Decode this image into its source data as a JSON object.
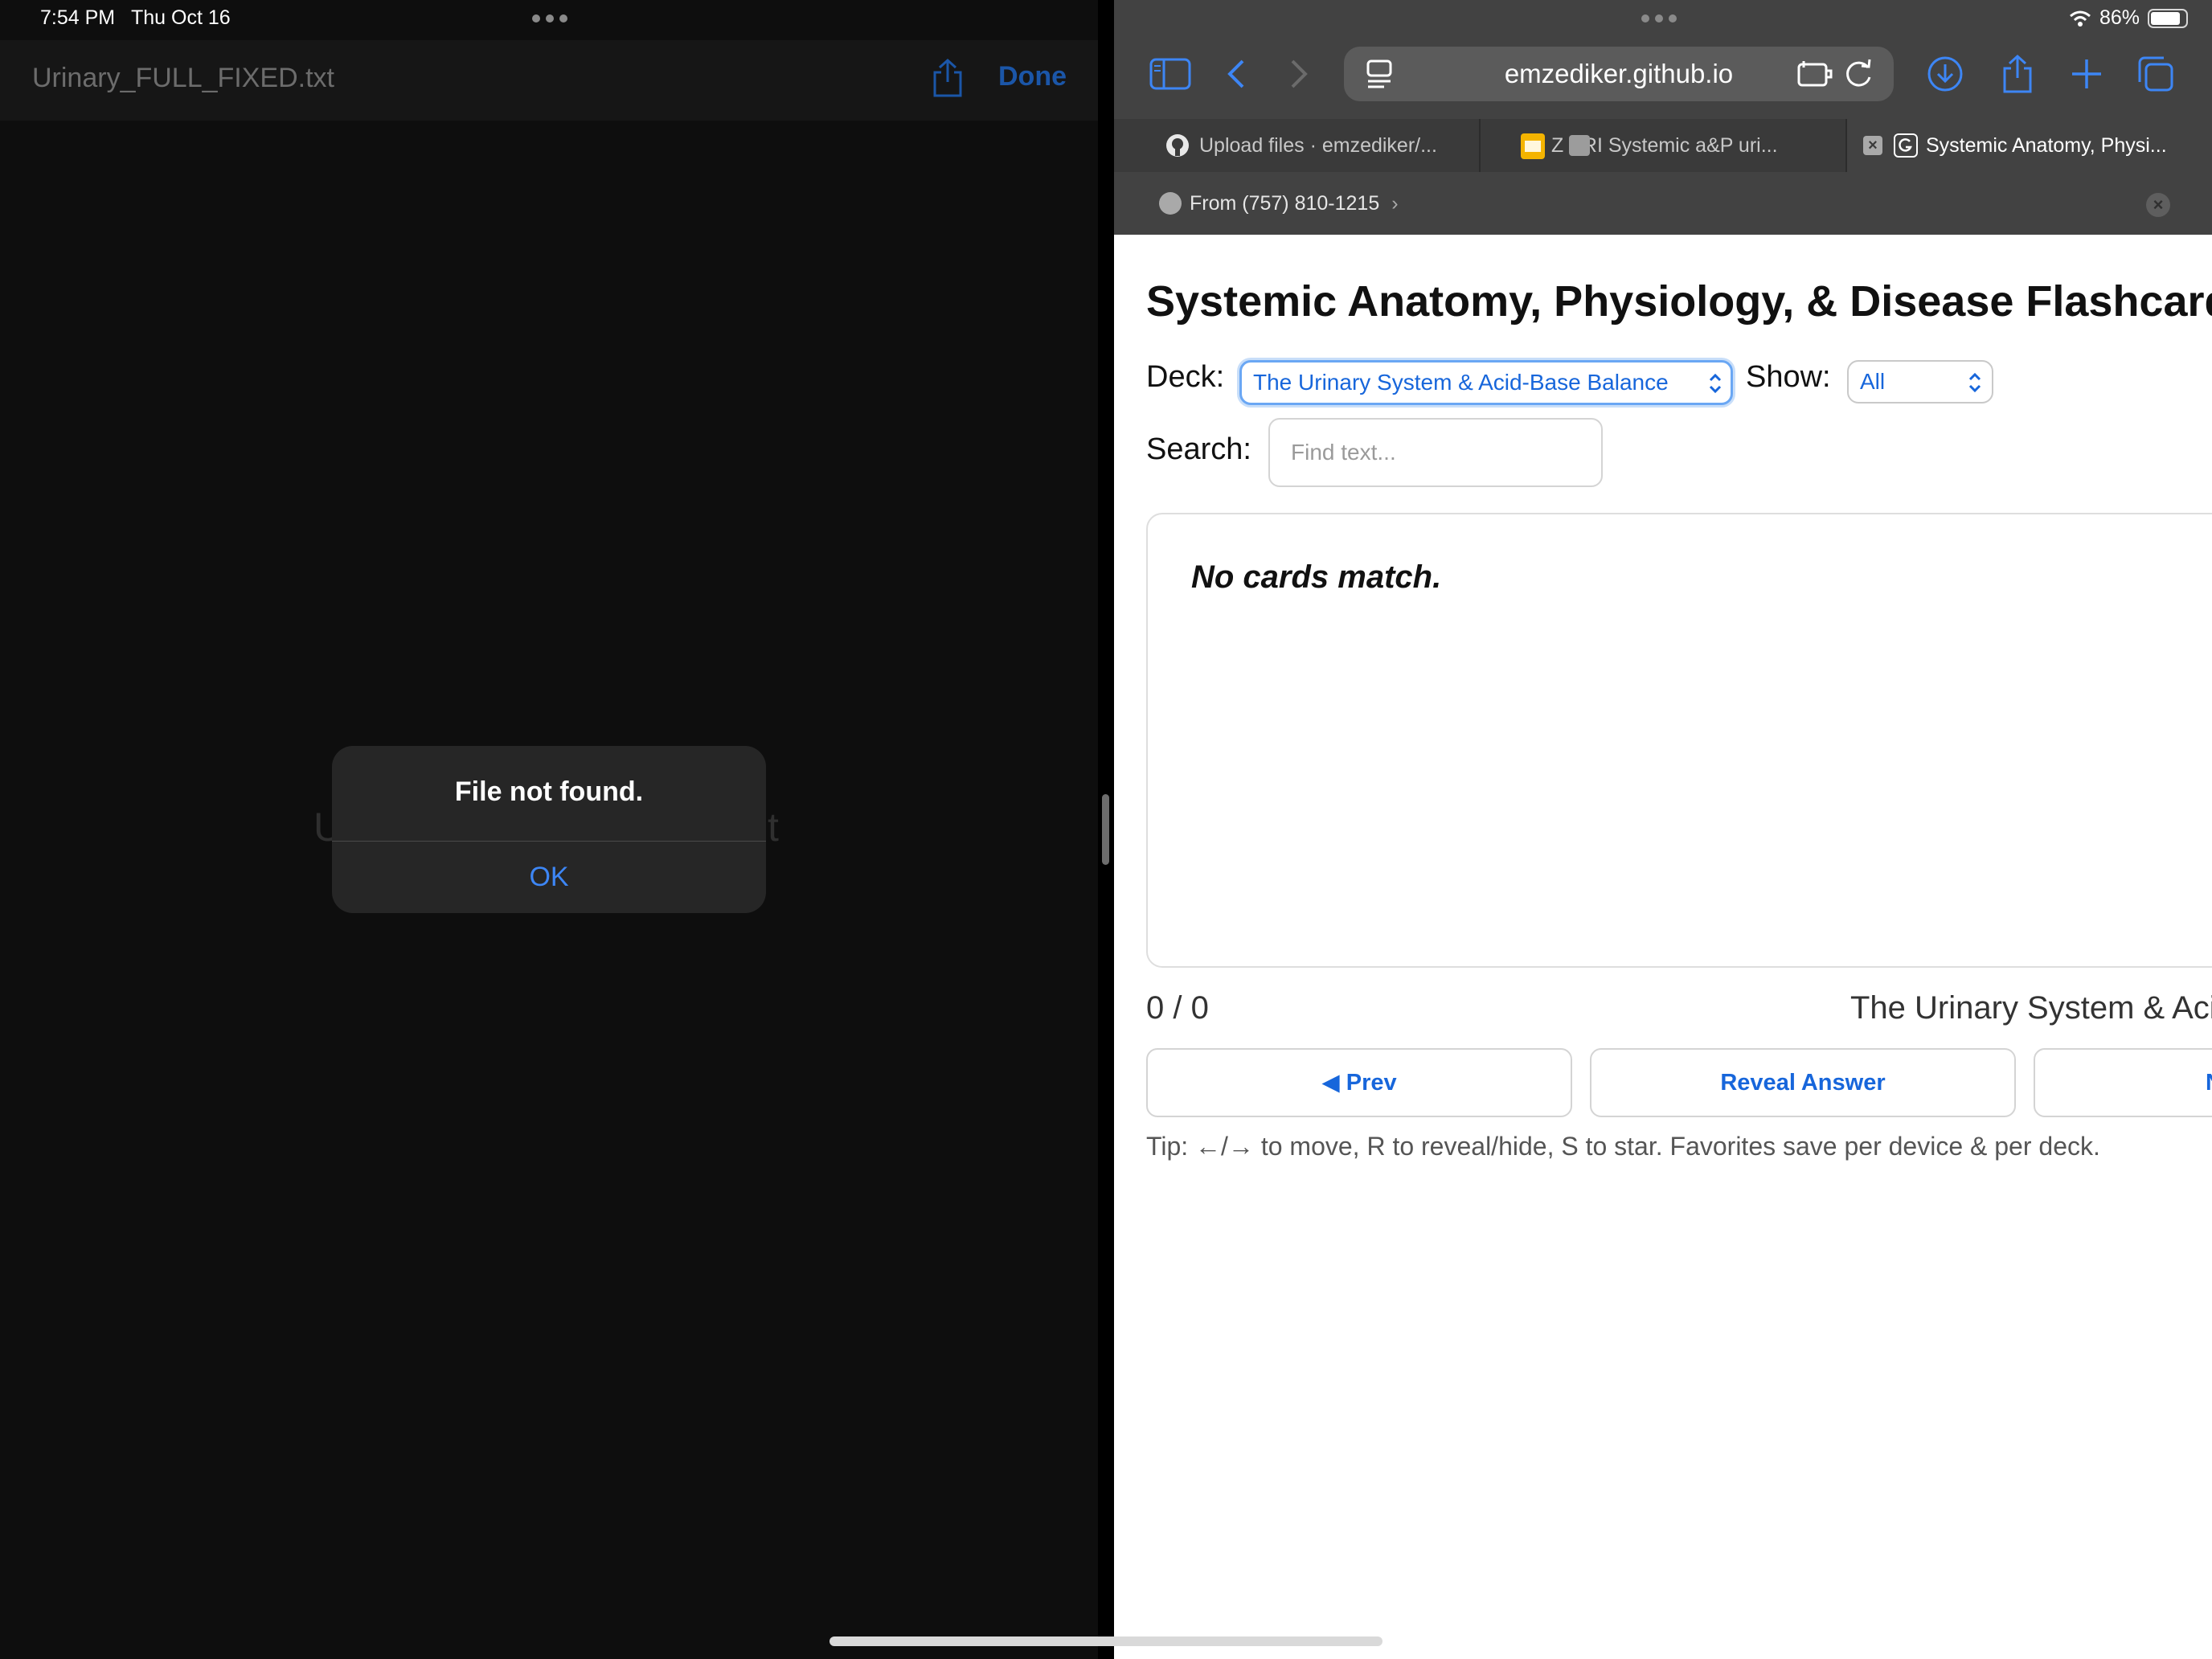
{
  "status": {
    "time": "7:54 PM",
    "date": "Thu Oct 16",
    "battery": "86%",
    "battery_level": 0.86
  },
  "left": {
    "file_title": "Urinary_FULL_FIXED.txt",
    "done_label": "Done",
    "doc_ghost_start": "U",
    "doc_ghost_end": "t",
    "alert": {
      "title": "File not found.",
      "ok_label": "OK"
    }
  },
  "safari": {
    "url": "emzediker.github.io",
    "tabs": [
      {
        "label": "Upload files · emzediker/...",
        "icon": "github-icon",
        "active": false
      },
      {
        "label": "Z  BRI Systemic a&P uri...",
        "icon": "slides-icon",
        "active": false
      },
      {
        "label": "Systemic Anatomy, Physi...",
        "icon": "g-favicon-icon",
        "active": true
      }
    ],
    "from_label": "From (757) 810-1215",
    "from_chevron": "›",
    "close_glyph": "×"
  },
  "page": {
    "title": "Systemic Anatomy, Physiology, & Disease Flashcards",
    "deck_label": "Deck:",
    "deck_value": "The Urinary System & Acid-Base Balance",
    "show_label": "Show:",
    "show_value": "All",
    "search_label": "Search:",
    "search_placeholder": "Find text...",
    "search_value": "",
    "empty_message": "No cards match.",
    "counter": "0 / 0",
    "deck_caption": "The Urinary System & Acid-Base Balance",
    "prev_label": "◀ Prev",
    "reveal_label": "Reveal Answer",
    "next_label": "Next ▶",
    "tip": "Tip: ←/→ to move, R to reveal/hide, S to star. Favorites save per device & per deck."
  },
  "colors": {
    "accent": "#1766db",
    "dark_bg": "#0e0e0e",
    "chrome": "#424242",
    "alert_ok": "#3d86f5"
  }
}
